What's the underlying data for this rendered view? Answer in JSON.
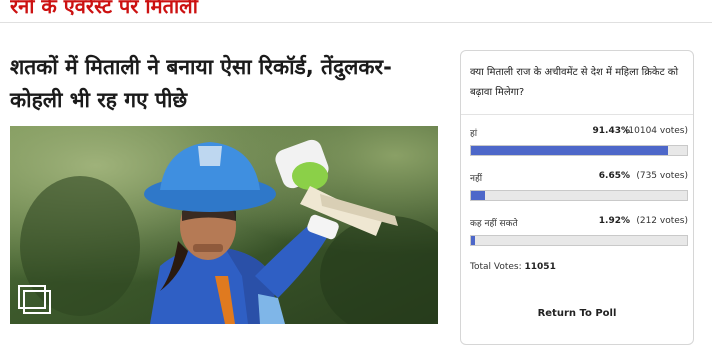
{
  "header": {
    "top_headline": "रनों के एवरेस्ट पर मिताली"
  },
  "article": {
    "title": "शतकों में मिताली ने बनाया ऐसा रिकॉर्ड, तेंदुलकर-कोहली भी रह गए पीछे",
    "gallery_icon": "gallery-icon"
  },
  "poll": {
    "question": "क्या मिताली राज के अचीवमेंट से देश में महिला क्रिकेट को बढ़ावा मिलेगा?",
    "options": [
      {
        "label": "हां",
        "percent": "91.43%",
        "votes": "(10104 votes)",
        "fraction": 0.9143
      },
      {
        "label": "नहीं",
        "percent": "6.65%",
        "votes": "(735 votes)",
        "fraction": 0.0665
      },
      {
        "label": "कह नहीं सकते",
        "percent": "1.92%",
        "votes": "(212 votes)",
        "fraction": 0.0192
      }
    ],
    "total_label": "Total Votes:",
    "total_value": "11051",
    "return_label": "Return To Poll",
    "bar_color": "#4d67c9"
  },
  "colors": {
    "headline_red": "#cc1111",
    "title_text": "#1b1b1b"
  }
}
